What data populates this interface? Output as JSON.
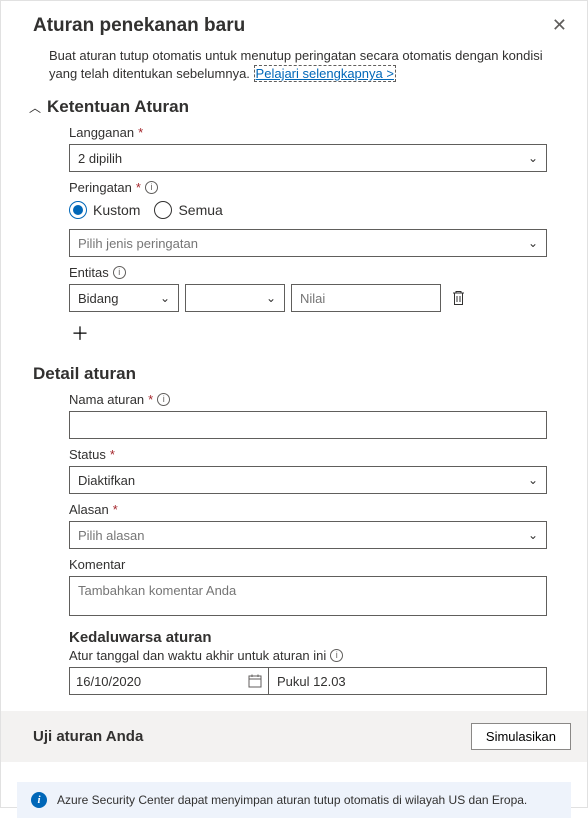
{
  "header": {
    "title": "Aturan penekanan baru",
    "close_label": "Close"
  },
  "description": {
    "text": "Buat aturan tutup otomatis untuk menutup peringatan secara otomatis dengan kondisi yang telah ditentukan sebelumnya.",
    "link": "Pelajari selengkapnya >"
  },
  "conditions": {
    "title": "Ketentuan Aturan",
    "subscription": {
      "label": "Langganan",
      "value": "2 dipilih"
    },
    "alerts": {
      "label": "Peringatan",
      "options": {
        "custom": "Kustom",
        "all": "Semua"
      },
      "selected": "custom",
      "type_placeholder": "Pilih jenis peringatan"
    },
    "entities": {
      "label": "Entitas",
      "field_value": "Bidang",
      "value_placeholder": "Nilai"
    }
  },
  "details": {
    "title": "Detail aturan",
    "name": {
      "label": "Nama aturan",
      "value": ""
    },
    "status": {
      "label": "Status",
      "value": "Diaktifkan"
    },
    "reason": {
      "label": "Alasan",
      "placeholder": "Pilih alasan"
    },
    "comment": {
      "label": "Komentar",
      "placeholder": "Tambahkan komentar Anda"
    },
    "expiration": {
      "title": "Kedaluwarsa aturan",
      "desc": "Atur tanggal dan waktu akhir untuk aturan ini",
      "date": "16/10/2020",
      "time": "Pukul 12.03"
    }
  },
  "test": {
    "title": "Uji aturan Anda",
    "button": "Simulasikan"
  },
  "info_banner": {
    "text": "Azure Security Center dapat menyimpan aturan tutup otomatis di wilayah US dan Eropa."
  }
}
